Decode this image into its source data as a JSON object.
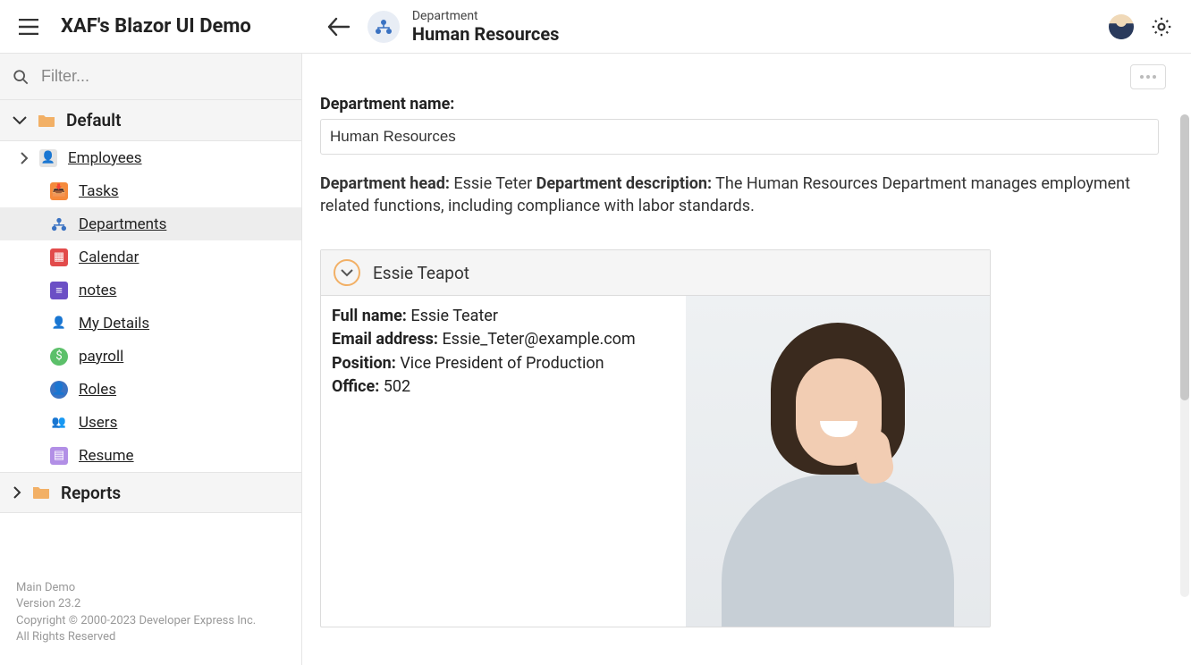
{
  "header": {
    "app_title": "XAF's Blazor UI Demo",
    "context_type": "Department",
    "context_title": "Human Resources"
  },
  "sidebar": {
    "filter_placeholder": "Filter...",
    "groups": {
      "default_label": "Default",
      "reports_label": "Reports"
    },
    "items": [
      {
        "label": "Employees",
        "icon": "employees-icon",
        "active": false
      },
      {
        "label": "Tasks",
        "icon": "tasks-icon",
        "active": false
      },
      {
        "label": "Departments",
        "icon": "departments-icon",
        "active": true
      },
      {
        "label": "Calendar",
        "icon": "calendar-icon",
        "active": false
      },
      {
        "label": "notes",
        "icon": "notes-icon",
        "active": false
      },
      {
        "label": "My Details",
        "icon": "mydetails-icon",
        "active": false
      },
      {
        "label": "payroll",
        "icon": "payroll-icon",
        "active": false
      },
      {
        "label": "Roles",
        "icon": "roles-icon",
        "active": false
      },
      {
        "label": "Users",
        "icon": "users-icon",
        "active": false
      },
      {
        "label": "Resume",
        "icon": "resume-icon",
        "active": false
      }
    ],
    "footer": {
      "line1": "Main Demo",
      "line2": "Version 23.2",
      "line3": "Copyright © 2000-2023 Developer Express Inc.",
      "line4": "All Rights Reserved"
    }
  },
  "main": {
    "field_label": "Department name:",
    "field_value": "Human Resources",
    "head_label": "Department head:",
    "head_value": "Essie Teter",
    "desc_label": "Department description:",
    "desc_value": "The Human Resources Department manages employment related functions, including compliance with labor standards.",
    "card": {
      "title": "Essie Teapot",
      "rows": {
        "fullname_label": "Full name:",
        "fullname_value": "Essie Teater",
        "email_label": "Email address:",
        "email_value": "Essie_Teter@example.com",
        "position_label": "Position:",
        "position_value": "Vice President of Production",
        "office_label": "Office:",
        "office_value": "502"
      }
    }
  }
}
